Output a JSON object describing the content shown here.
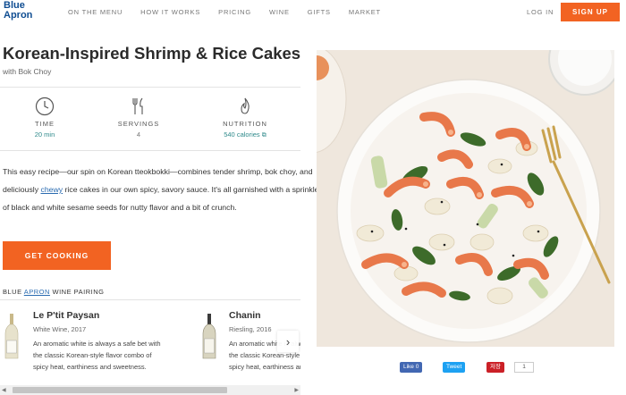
{
  "header": {
    "logo_line1": "Blue",
    "logo_line2": "Apron",
    "nav": [
      "ON THE MENU",
      "HOW IT WORKS",
      "PRICING",
      "WINE",
      "GIFTS",
      "MARKET"
    ],
    "login": "LOG IN",
    "signup": "SIGN UP"
  },
  "recipe": {
    "title": "Korean-Inspired Shrimp & Rice Cakes",
    "subtitle": "with Bok Choy",
    "stats": {
      "time_label": "TIME",
      "time_value": "20 min",
      "servings_label": "SERVINGS",
      "servings_value": "4",
      "nutrition_label": "NUTRITION",
      "nutrition_value": "540 calories"
    },
    "description": {
      "part1": "This easy recipe—our spin on Korean tteokbokki—combines tender shrimp, bok choy, and deliciously ",
      "link": "chewy",
      "part2": " rice cakes in our own spicy, savory sauce. It's all garnished with a sprinkle of black and white sesame seeds for nutty flavor and a bit of crunch."
    },
    "cta": "GET COOKING"
  },
  "pairing": {
    "prefix": "BLUE ",
    "link": "APRON",
    "suffix": " WINE PAIRING",
    "wines": [
      {
        "name": "Le P'tit Paysan",
        "type": "White Wine, 2017",
        "text": "An aromatic white is always a safe bet with the classic Korean-style flavor combo of spicy heat, earthiness and sweetness."
      },
      {
        "name": "Chanin",
        "type": "Riesling, 2016",
        "text": "An aromatic white is always a safe bet with the classic Korean-style flavor combo of spicy heat, earthiness and sweetness."
      }
    ]
  },
  "share": {
    "facebook": "Like 0",
    "twitter": "Tweet",
    "pinterest": "저장",
    "pin_count": "1"
  },
  "icons": {
    "arrow": "›",
    "scroll_left": "◀",
    "scroll_right": "▶"
  },
  "colors": {
    "brand_blue": "#0f4d92",
    "accent_orange": "#f26322",
    "teal": "#2f8a8b",
    "link_blue": "#2a6bb0"
  }
}
